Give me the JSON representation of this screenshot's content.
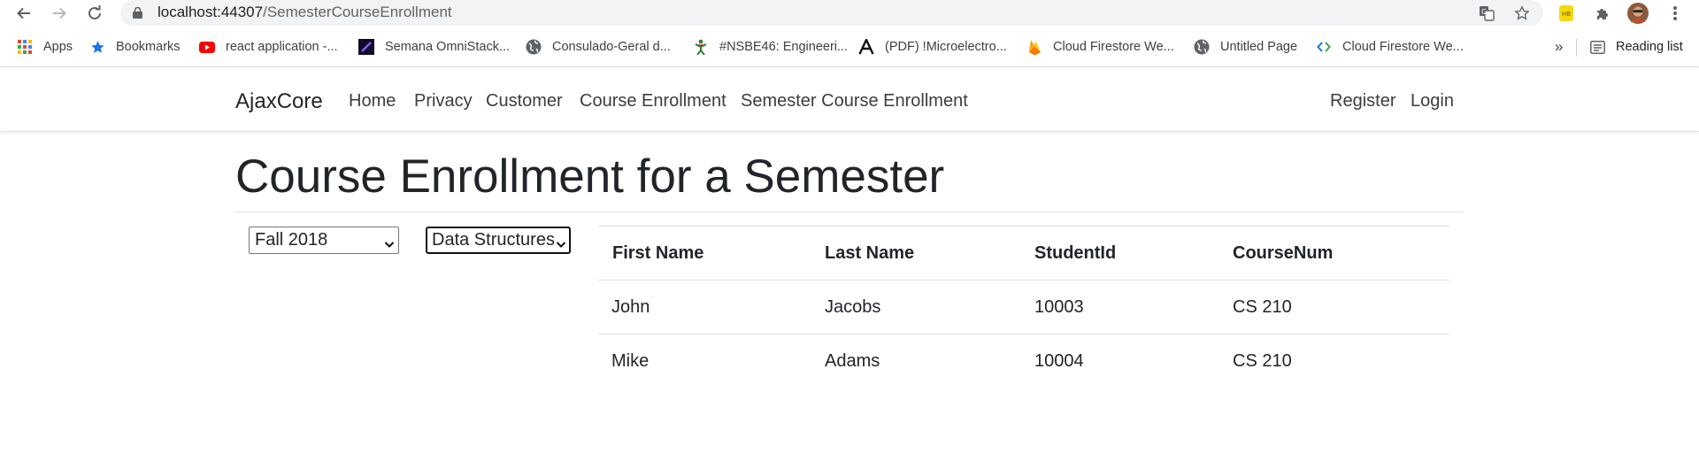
{
  "browser": {
    "url_host": "localhost:44307",
    "url_path": "/SemesterCourseEnrollment",
    "bookmarks": [
      {
        "label": "Apps",
        "icon": "apps-grid-icon"
      },
      {
        "label": "Bookmarks",
        "icon": "star-icon"
      },
      {
        "label": "react application -...",
        "icon": "youtube-icon"
      },
      {
        "label": "Semana OmniStack...",
        "icon": "omnistack-icon"
      },
      {
        "label": "Consulado-Geral d...",
        "icon": "globe-icon"
      },
      {
        "label": "#NSBE46: Engineeri...",
        "icon": "nsbe-icon"
      },
      {
        "label": "(PDF) !Microelectro...",
        "icon": "academia-icon"
      },
      {
        "label": "Cloud Firestore We...",
        "icon": "firebase-icon"
      },
      {
        "label": "Untitled Page",
        "icon": "globe-icon"
      },
      {
        "label": "Cloud Firestore We...",
        "icon": "code-icon"
      }
    ],
    "overflow": "»",
    "reading_list": "Reading list"
  },
  "navbar": {
    "brand": "AjaxCore",
    "links": [
      "Home",
      "Privacy",
      "Customer",
      "Course Enrollment",
      "Semester Course Enrollment"
    ],
    "right_links": [
      "Register",
      "Login"
    ]
  },
  "main": {
    "title": "Course Enrollment for a Semester",
    "semester_select": {
      "value": "Fall 2018"
    },
    "course_select": {
      "value": "Data Structures"
    },
    "table": {
      "headers": [
        "First Name",
        "Last Name",
        "StudentId",
        "CourseNum"
      ],
      "rows": [
        [
          "John",
          "Jacobs",
          "10003",
          "CS 210"
        ],
        [
          "Mike",
          "Adams",
          "10004",
          "CS 210"
        ]
      ]
    }
  },
  "colors": {
    "text": "#212529",
    "nav_link": "#3d3d3d",
    "omnibox": "#f1f3f4",
    "youtube": "#ff0000",
    "bookmark_star": "#1a73e8"
  }
}
